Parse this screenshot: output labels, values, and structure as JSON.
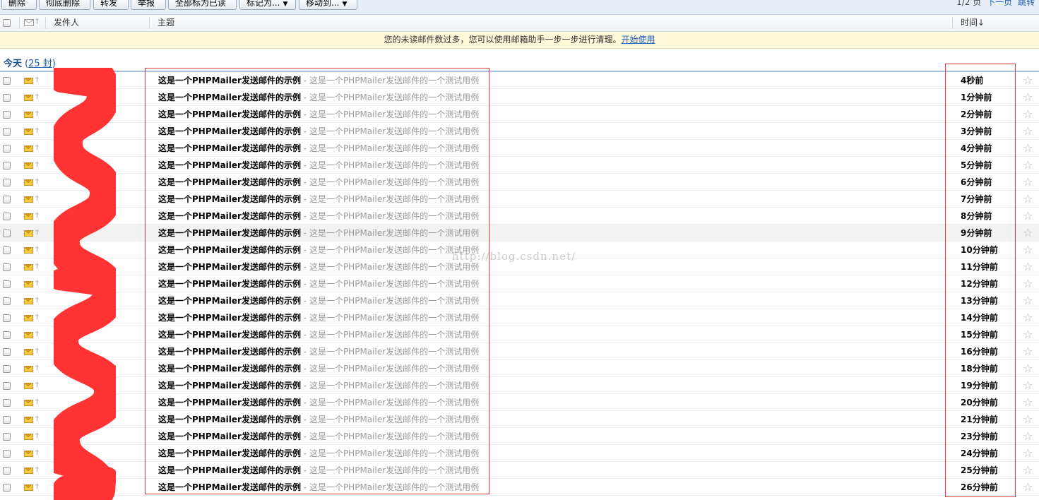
{
  "toolbar": {
    "buttons": [
      "删除",
      "彻底删除",
      "转发",
      "举报",
      "全部标为已读",
      "标记为...",
      "移动到..."
    ],
    "page_info": "1/2 页",
    "next_page": "下一页",
    "jump": "跳转"
  },
  "header": {
    "sender": "发件人",
    "subject": "主题",
    "time": "时间↓"
  },
  "notice": {
    "text": "您的未读邮件数过多，您可以使用邮箱助手一步一步进行清理。",
    "link": "开始使用"
  },
  "group": {
    "label": "今天",
    "count": "25 封"
  },
  "watermark": "http://blog.csdn.net/",
  "emails": [
    {
      "subject": "这是一个PHPMailer发送邮件的示例",
      "preview": "- 这是一个PHPMailer发送邮件的一个测试用例",
      "time": "4秒前"
    },
    {
      "subject": "这是一个PHPMailer发送邮件的示例",
      "preview": "- 这是一个PHPMailer发送邮件的一个测试用例",
      "time": "1分钟前"
    },
    {
      "subject": "这是一个PHPMailer发送邮件的示例",
      "preview": "- 这是一个PHPMailer发送邮件的一个测试用例",
      "time": "2分钟前"
    },
    {
      "subject": "这是一个PHPMailer发送邮件的示例",
      "preview": "- 这是一个PHPMailer发送邮件的一个测试用例",
      "time": "3分钟前"
    },
    {
      "subject": "这是一个PHPMailer发送邮件的示例",
      "preview": "- 这是一个PHPMailer发送邮件的一个测试用例",
      "time": "4分钟前"
    },
    {
      "subject": "这是一个PHPMailer发送邮件的示例",
      "preview": "- 这是一个PHPMailer发送邮件的一个测试用例",
      "time": "5分钟前"
    },
    {
      "subject": "这是一个PHPMailer发送邮件的示例",
      "preview": "- 这是一个PHPMailer发送邮件的一个测试用例",
      "time": "6分钟前"
    },
    {
      "subject": "这是一个PHPMailer发送邮件的示例",
      "preview": "- 这是一个PHPMailer发送邮件的一个测试用例",
      "time": "7分钟前"
    },
    {
      "subject": "这是一个PHPMailer发送邮件的示例",
      "preview": "- 这是一个PHPMailer发送邮件的一个测试用例",
      "time": "8分钟前"
    },
    {
      "subject": "这是一个PHPMailer发送邮件的示例",
      "preview": "- 这是一个PHPMailer发送邮件的一个测试用例",
      "time": "9分钟前"
    },
    {
      "subject": "这是一个PHPMailer发送邮件的示例",
      "preview": "- 这是一个PHPMailer发送邮件的一个测试用例",
      "time": "10分钟前"
    },
    {
      "subject": "这是一个PHPMailer发送邮件的示例",
      "preview": "- 这是一个PHPMailer发送邮件的一个测试用例",
      "time": "11分钟前"
    },
    {
      "subject": "这是一个PHPMailer发送邮件的示例",
      "preview": "- 这是一个PHPMailer发送邮件的一个测试用例",
      "time": "12分钟前"
    },
    {
      "subject": "这是一个PHPMailer发送邮件的示例",
      "preview": "- 这是一个PHPMailer发送邮件的一个测试用例",
      "time": "13分钟前"
    },
    {
      "subject": "这是一个PHPMailer发送邮件的示例",
      "preview": "- 这是一个PHPMailer发送邮件的一个测试用例",
      "time": "14分钟前"
    },
    {
      "subject": "这是一个PHPMailer发送邮件的示例",
      "preview": "- 这是一个PHPMailer发送邮件的一个测试用例",
      "time": "15分钟前"
    },
    {
      "subject": "这是一个PHPMailer发送邮件的示例",
      "preview": "- 这是一个PHPMailer发送邮件的一个测试用例",
      "time": "16分钟前"
    },
    {
      "subject": "这是一个PHPMailer发送邮件的示例",
      "preview": "- 这是一个PHPMailer发送邮件的一个测试用例",
      "time": "18分钟前"
    },
    {
      "subject": "这是一个PHPMailer发送邮件的示例",
      "preview": "- 这是一个PHPMailer发送邮件的一个测试用例",
      "time": "19分钟前"
    },
    {
      "subject": "这是一个PHPMailer发送邮件的示例",
      "preview": "- 这是一个PHPMailer发送邮件的一个测试用例",
      "time": "20分钟前"
    },
    {
      "subject": "这是一个PHPMailer发送邮件的示例",
      "preview": "- 这是一个PHPMailer发送邮件的一个测试用例",
      "time": "21分钟前"
    },
    {
      "subject": "这是一个PHPMailer发送邮件的示例",
      "preview": "- 这是一个PHPMailer发送邮件的一个测试用例",
      "time": "23分钟前"
    },
    {
      "subject": "这是一个PHPMailer发送邮件的示例",
      "preview": "- 这是一个PHPMailer发送邮件的一个测试用例",
      "time": "24分钟前"
    },
    {
      "subject": "这是一个PHPMailer发送邮件的示例",
      "preview": "- 这是一个PHPMailer发送邮件的一个测试用例",
      "time": "25分钟前"
    },
    {
      "subject": "这是一个PHPMailer发送邮件的示例",
      "preview": "- 这是一个PHPMailer发送邮件的一个测试用例",
      "time": "26分钟前"
    }
  ],
  "icons": {
    "unread": "envelope-icon",
    "attachment": "paperclip-icon",
    "star": "star-icon"
  },
  "colors": {
    "annotation": "#e0383a",
    "redaction": "#ff3333",
    "link": "#1a5fb4",
    "notice_bg": "#fff9db"
  }
}
